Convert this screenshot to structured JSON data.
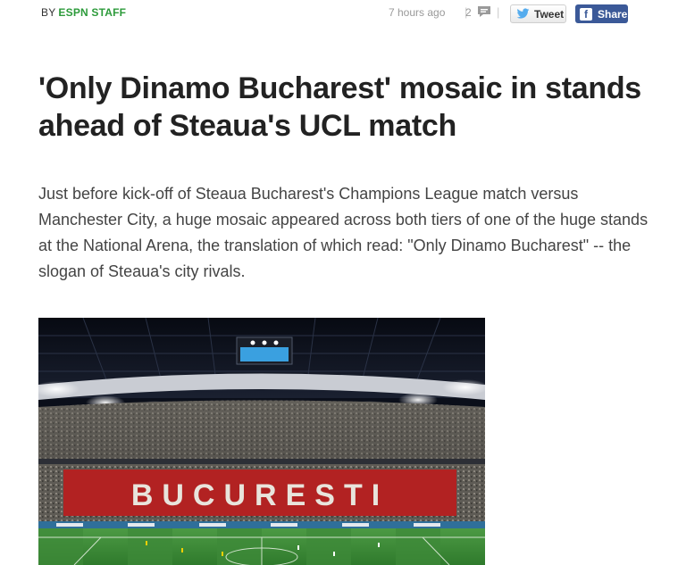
{
  "byline": {
    "prefix": "BY",
    "author": "ESPN STAFF"
  },
  "meta": {
    "timestamp": "7 hours ago",
    "comment_count": "2",
    "separator": "|"
  },
  "social": {
    "tweet_label": "Tweet",
    "share_label": "Share",
    "facebook_glyph": "f"
  },
  "article": {
    "headline": "'Only Dinamo Bucharest' mosaic in stands ahead of Steaua's UCL match",
    "body": "Just before kick-off of Steaua Bucharest's Champions League match versus Manchester City, a huge mosaic appeared across both tiers of one of the huge stands at the National Arena, the translation of which read: \"Only Dinamo Bucharest\" -- the slogan of Steaua's city rivals."
  },
  "photo": {
    "mosaic_text": "BUCURESTI",
    "colors": {
      "mosaic_red": "#b22222",
      "pitch_green": "#3f8f3a",
      "roof_dark": "#0d1220",
      "screen_blue": "#3aa0e0"
    }
  },
  "colors": {
    "author_green": "#2d9b3b",
    "facebook_blue": "#3b5998",
    "headline": "#222222",
    "body_text": "#444444",
    "meta_gray": "#999999"
  }
}
